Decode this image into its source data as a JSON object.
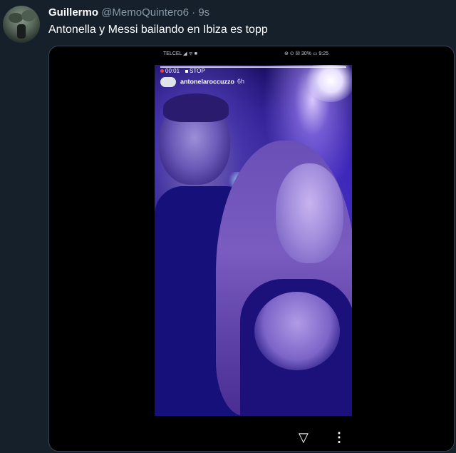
{
  "tweet": {
    "display_name": "Guillermo",
    "handle": "@MemoQuintero6",
    "separator": "·",
    "time": "9s",
    "text": "Antonella y Messi bailando en Ibiza es topp"
  },
  "phone_status": {
    "carrier": "TELCEL ◢ ᯤ ■",
    "right": "⊛ ⊙ ☒ 30% ▭ 9:25"
  },
  "story": {
    "record_time": "00:01",
    "stop_label": "STOP",
    "username": "antonelaroccuzzo",
    "posted": "6h"
  },
  "controls": {
    "share_icon": "send-icon",
    "more_icon": "more-vertical-icon",
    "share_glyph": "▽",
    "more_glyph": "⋮"
  },
  "colors": {
    "background": "#15202b",
    "secondary_text": "#8899a6"
  }
}
